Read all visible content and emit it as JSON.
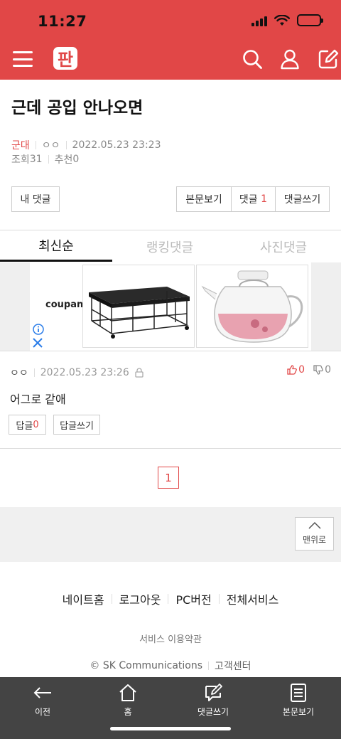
{
  "status": {
    "time": "11:27"
  },
  "header": {
    "logo_text": "판"
  },
  "post": {
    "title": "근데 공입 안나오면",
    "category": "군대",
    "author": "ㅇㅇ",
    "datetime": "2022.05.23 23:23",
    "views_label": "조회",
    "views": "31",
    "recommend_label": "추천",
    "recommend": "0"
  },
  "actions": {
    "my_comments": "내 댓글",
    "view_post": "본문보기",
    "comments_label": "댓글",
    "comments_count": "1",
    "write_comment": "댓글쓰기"
  },
  "tabs": [
    {
      "label": "최신순",
      "active": true
    },
    {
      "label": "랭킹댓글",
      "active": false
    },
    {
      "label": "사진댓글",
      "active": false
    }
  ],
  "ad": {
    "brand": "coupang"
  },
  "comment": {
    "author": "ㅇㅇ",
    "datetime": "2022.05.23 23:26",
    "likes": "0",
    "dislikes": "0",
    "body": "어그로 같애",
    "reply_label": "답글",
    "reply_count": "0",
    "write_reply": "답글쓰기"
  },
  "pagination": {
    "current": "1"
  },
  "to_top": "맨위로",
  "footer": {
    "links": [
      "네이트홈",
      "로그아웃",
      "PC버전",
      "전체서비스"
    ],
    "terms": "서비스 이용약관",
    "copyright": "© SK Communications",
    "support": "고객센터"
  },
  "bottom_nav": [
    {
      "label": "이전",
      "icon": "back-arrow-icon"
    },
    {
      "label": "홈",
      "icon": "home-icon"
    },
    {
      "label": "댓글쓰기",
      "icon": "write-comment-icon"
    },
    {
      "label": "본문보기",
      "icon": "document-icon"
    }
  ],
  "colors": {
    "brand": "#e14747",
    "bottom_bar": "#444444"
  }
}
